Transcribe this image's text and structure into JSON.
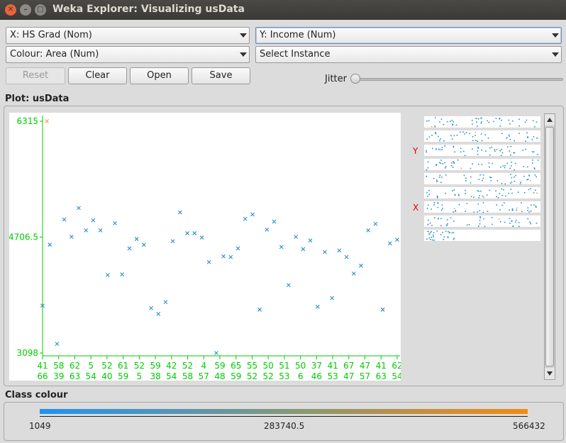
{
  "window": {
    "title": "Weka Explorer: Visualizing usData"
  },
  "controls": {
    "x_axis": "X: HS Grad (Nom)",
    "y_axis": "Y: Income (Num)",
    "colour": "Colour: Area (Num)",
    "select_instance": "Select Instance",
    "reset_label": "Reset",
    "clear_label": "Clear",
    "open_label": "Open",
    "save_label": "Save",
    "jitter_label": "Jitter",
    "jitter_value": 0
  },
  "plot": {
    "label": "Plot: usData",
    "y_ticks": [
      "6315",
      "4706.5",
      "3098"
    ],
    "x_ticks_row1": [
      "41",
      "58",
      "62",
      "5",
      "52",
      "61",
      "52",
      "59",
      "42",
      "52",
      "4",
      "59",
      "65",
      "55",
      "50",
      "51",
      "50",
      "37",
      "41",
      "67",
      "47",
      "41",
      "62"
    ],
    "x_ticks_row2": [
      "66",
      "39",
      "63",
      "54",
      "40",
      "59",
      "5",
      "38",
      "54",
      "58",
      "57",
      "48",
      "59",
      "52",
      "52",
      "53",
      "6",
      "46",
      "53",
      "47",
      "57",
      "63",
      "54"
    ]
  },
  "chart_data": {
    "type": "scatter",
    "xlabel": "HS Grad",
    "ylabel": "Income",
    "ylim": [
      3098,
      6315
    ],
    "series": [
      {
        "values": [
          [
            0,
            3755
          ],
          [
            1,
            4600
          ],
          [
            2,
            3225
          ],
          [
            3,
            4950
          ],
          [
            4,
            4710
          ],
          [
            5,
            5110
          ],
          [
            6,
            4800
          ],
          [
            7,
            4940
          ],
          [
            8,
            4800
          ],
          [
            9,
            4180
          ],
          [
            10,
            4900
          ],
          [
            11,
            4190
          ],
          [
            12,
            4550
          ],
          [
            13,
            4680
          ],
          [
            14,
            4600
          ],
          [
            15,
            3720
          ],
          [
            16,
            3640
          ],
          [
            17,
            3805
          ],
          [
            18,
            4650
          ],
          [
            19,
            5050
          ],
          [
            20,
            4760
          ],
          [
            21,
            4760
          ],
          [
            22,
            4700
          ],
          [
            23,
            4360
          ],
          [
            24,
            3098
          ],
          [
            25,
            4440
          ],
          [
            26,
            4430
          ],
          [
            27,
            4550
          ],
          [
            28,
            4960
          ],
          [
            29,
            5020
          ],
          [
            30,
            3700
          ],
          [
            31,
            4810
          ],
          [
            32,
            4920
          ],
          [
            33,
            4570
          ],
          [
            34,
            4040
          ],
          [
            35,
            4710
          ],
          [
            36,
            4540
          ],
          [
            37,
            4660
          ],
          [
            38,
            3740
          ],
          [
            39,
            4500
          ],
          [
            40,
            3860
          ],
          [
            41,
            4520
          ],
          [
            42,
            4430
          ],
          [
            43,
            4200
          ],
          [
            44,
            4310
          ],
          [
            45,
            4800
          ],
          [
            46,
            4890
          ],
          [
            47,
            3700
          ],
          [
            48,
            4620
          ],
          [
            49,
            4670
          ],
          [
            0.6,
            6315
          ]
        ]
      }
    ],
    "colour_attribute": "Area",
    "colour_scale": {
      "min": "1049",
      "mid": "283740.5",
      "max": "566432",
      "low_color": "#1f93f2",
      "high_color": "#f58a14"
    }
  },
  "mini_plots": {
    "y_marker": "Y",
    "x_marker": "X"
  },
  "class_colour": {
    "label": "Class colour",
    "min": "1049",
    "mid": "283740.5",
    "max": "566432"
  },
  "colors": {
    "axis_green": "#00cc00",
    "point_blue": "#2a8fd0",
    "point_orange": "#f0a040",
    "marker_red": "#e00000"
  }
}
